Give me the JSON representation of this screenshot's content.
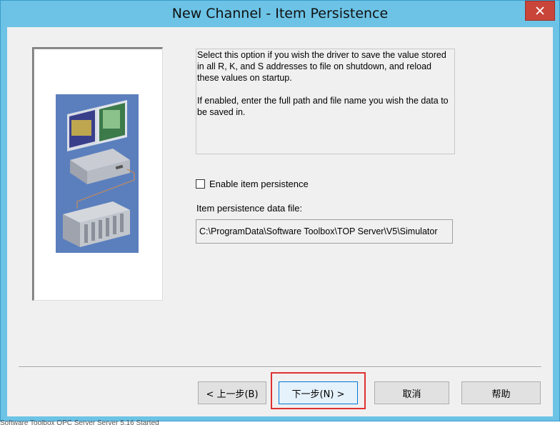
{
  "window": {
    "title": "New Channel - Item Persistence",
    "close_icon": "close-icon"
  },
  "description": {
    "paragraph1": "Select this option if you wish the driver to save the value stored in all R, K, and S addresses to file on shutdown, and reload these values on startup.",
    "paragraph2": "If enabled, enter the full path and file name you wish the data to be saved in."
  },
  "enable_persistence": {
    "label": "Enable item persistence",
    "checked": false
  },
  "data_file": {
    "label": "Item persistence data file:",
    "value": "C:\\ProgramData\\Software Toolbox\\TOP Server\\V5\\Simulator"
  },
  "buttons": {
    "back": "< 上一步(B)",
    "next": "下一步(N) >",
    "cancel": "取消",
    "help": "帮助"
  },
  "background_status": "Software Toolbox OPC Server Server 5.16 Started",
  "colors": {
    "titlebar": "#6cc3e6",
    "close_button": "#c9453a",
    "highlight": "#e03030",
    "illustration_bg": "#5b7fbd"
  }
}
